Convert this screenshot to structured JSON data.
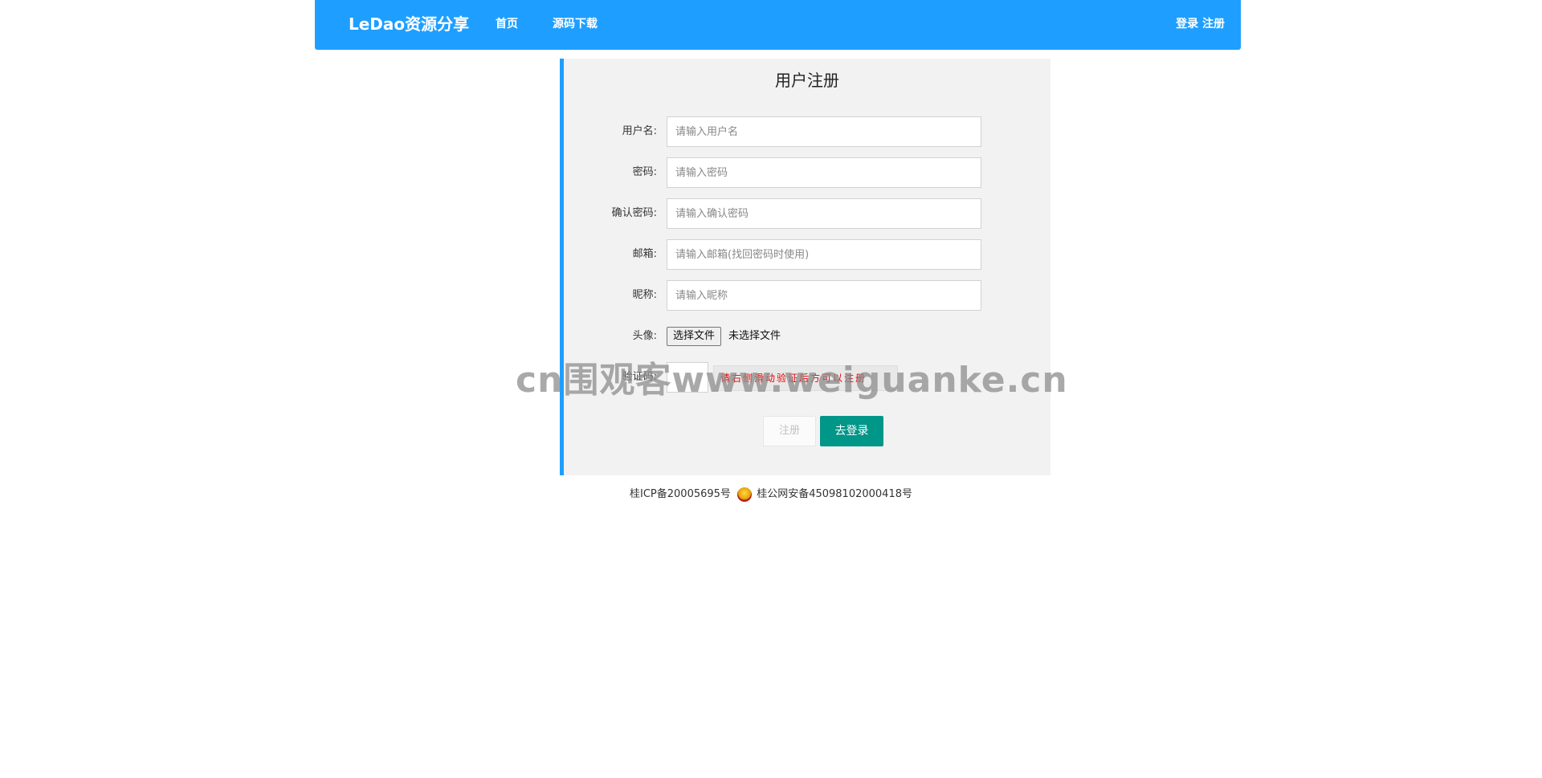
{
  "navbar": {
    "brand": "LeDao资源分享",
    "links": [
      "首页",
      "源码下载"
    ],
    "login": "登录",
    "register": "注册"
  },
  "form": {
    "title": "用户注册",
    "fields": [
      {
        "label": "用户名:",
        "placeholder": "请输入用户名"
      },
      {
        "label": "密码:",
        "placeholder": "请输入密码"
      },
      {
        "label": "确认密码:",
        "placeholder": "请输入确认密码"
      },
      {
        "label": "邮箱:",
        "placeholder": "请输入邮箱(找回密码时使用)"
      },
      {
        "label": "昵称:",
        "placeholder": "请输入昵称"
      }
    ],
    "avatar": {
      "label": "头像:",
      "button": "选择文件",
      "status": "未选择文件"
    },
    "captcha": {
      "label": "验证码:",
      "hint": "请右侧滑动验证后方可以注册"
    },
    "register_button": "注册",
    "login_button": "去登录"
  },
  "footer": {
    "icp": "桂ICP备20005695号",
    "police": "桂公网安备45098102000418号"
  },
  "watermark": "cn围观客www.weiguanke.cn"
}
